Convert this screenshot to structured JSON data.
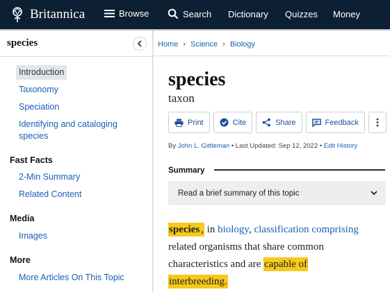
{
  "topbar": {
    "brand": "Britannica",
    "nav": [
      {
        "label": "Browse",
        "icon": "menu-icon"
      },
      {
        "label": "Search",
        "icon": "search-icon"
      },
      {
        "label": "Dictionary"
      },
      {
        "label": "Quizzes"
      },
      {
        "label": "Money"
      }
    ]
  },
  "sidebar": {
    "title": "species",
    "toc": [
      {
        "label": "Introduction",
        "active": true
      },
      {
        "label": "Taxonomy"
      },
      {
        "label": "Speciation"
      },
      {
        "label": "Identifying and cataloging species"
      }
    ],
    "sections": [
      {
        "heading": "Fast Facts",
        "items": [
          "2-Min Summary",
          "Related Content"
        ]
      },
      {
        "heading": "Media",
        "items": [
          "Images"
        ]
      },
      {
        "heading": "More",
        "items": [
          "More Articles On This Topic"
        ]
      }
    ]
  },
  "breadcrumb": [
    "Home",
    "Science",
    "Biology"
  ],
  "article": {
    "title": "species",
    "subtitle": "taxon",
    "toolbar": [
      "Print",
      "Cite",
      "Share",
      "Feedback"
    ],
    "byline": {
      "prefix": "By",
      "author": "John L. Gittleman",
      "updated": "• Last Updated: Sep 12, 2022 •",
      "history": "Edit History"
    },
    "summary_label": "Summary",
    "summary_toggle": "Read a brief summary of this topic",
    "body": {
      "term": "species",
      "comma1": ",",
      "in": " in ",
      "biology": "biology",
      "comma2": ",",
      "classification": "classification",
      "comprising": "comprising",
      "line2": "related organisms that share common",
      "line3a": "characteristics and are ",
      "capable": "capable of",
      "interbreeding": "interbreeding",
      "period": "."
    }
  },
  "colors": {
    "topbar": "#0d1f33",
    "link": "#1a5fb4",
    "highlight": "#f7c91c"
  }
}
